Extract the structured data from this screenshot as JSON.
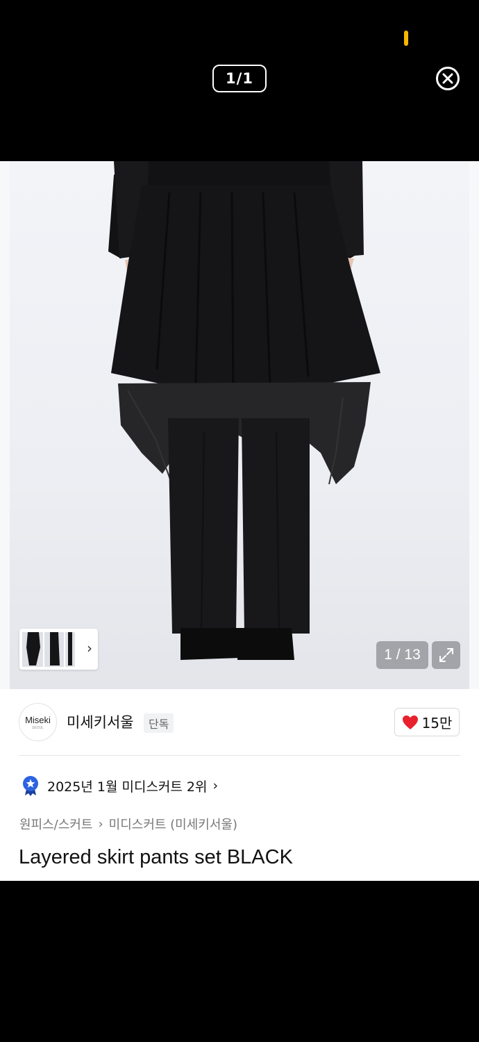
{
  "viewer": {
    "counter": "1/1",
    "close_icon": "close-circle-icon"
  },
  "product": {
    "image_counter": "1 / 13",
    "expand_icon": "expand-icon",
    "brand": {
      "logo_text": "Miseki",
      "logo_subtext": "SEOUL",
      "name": "미세키서울",
      "badge": "단독"
    },
    "likes": "15만",
    "ranking": "2025년 1월 미디스커트 2위",
    "breadcrumb": {
      "category": "원피스/스커트",
      "subcategory": "미디스커트 (미세키서울)"
    },
    "title": "Layered skirt pants set BLACK"
  },
  "colors": {
    "accent_heart": "#e8212d",
    "status_yellow": "#f5b700",
    "ranking_badge": "#2b63e0"
  }
}
